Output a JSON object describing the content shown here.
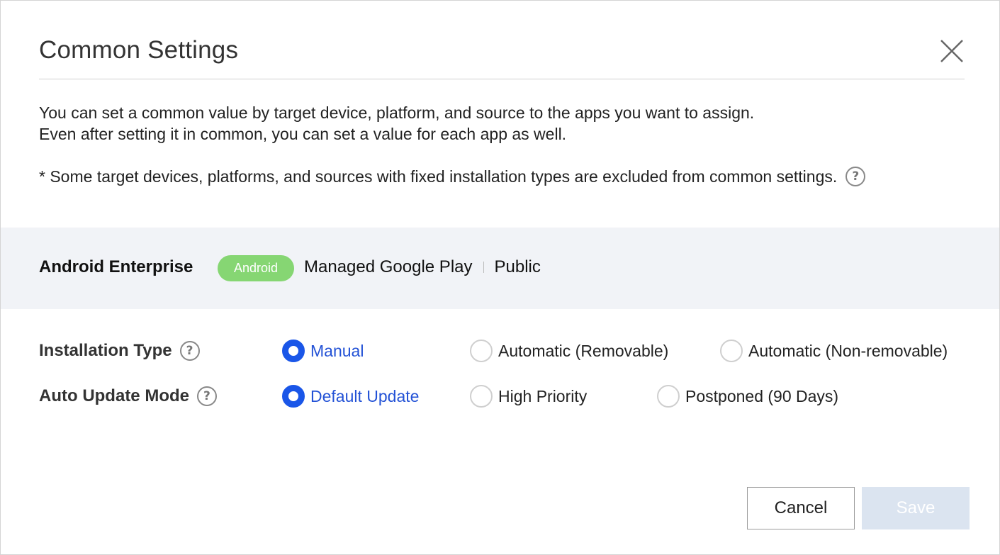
{
  "dialog": {
    "title": "Common Settings",
    "close_icon": "close-icon"
  },
  "description": {
    "line1": "You can set a common value by target device, platform, and source to the apps you want to assign.",
    "line2": "Even after setting it in common, you can set a value for each app as well.",
    "note": "* Some target devices, platforms, and sources with fixed installation types are excluded from common settings.",
    "help_icon": "question-circle-icon"
  },
  "platform": {
    "label": "Android Enterprise",
    "badge": "Android",
    "badge_color": "#86d673",
    "source": "Managed Google Play",
    "type": "Public"
  },
  "installation_type": {
    "label": "Installation Type",
    "options": [
      {
        "label": "Manual",
        "selected": true
      },
      {
        "label": "Automatic (Removable)",
        "selected": false
      },
      {
        "label": "Automatic (Non-removable)",
        "selected": false
      }
    ]
  },
  "auto_update_mode": {
    "label": "Auto Update Mode",
    "options": [
      {
        "label": "Default Update",
        "selected": true
      },
      {
        "label": "High Priority",
        "selected": false
      },
      {
        "label": "Postponed (90 Days)",
        "selected": false
      }
    ]
  },
  "footer": {
    "cancel_label": "Cancel",
    "save_label": "Save",
    "save_enabled": false
  },
  "colors": {
    "accent": "#1a56e8",
    "selected_text": "#2352d6",
    "platform_bar_bg": "#f1f3f7",
    "save_disabled_bg": "#dbe4f0"
  }
}
